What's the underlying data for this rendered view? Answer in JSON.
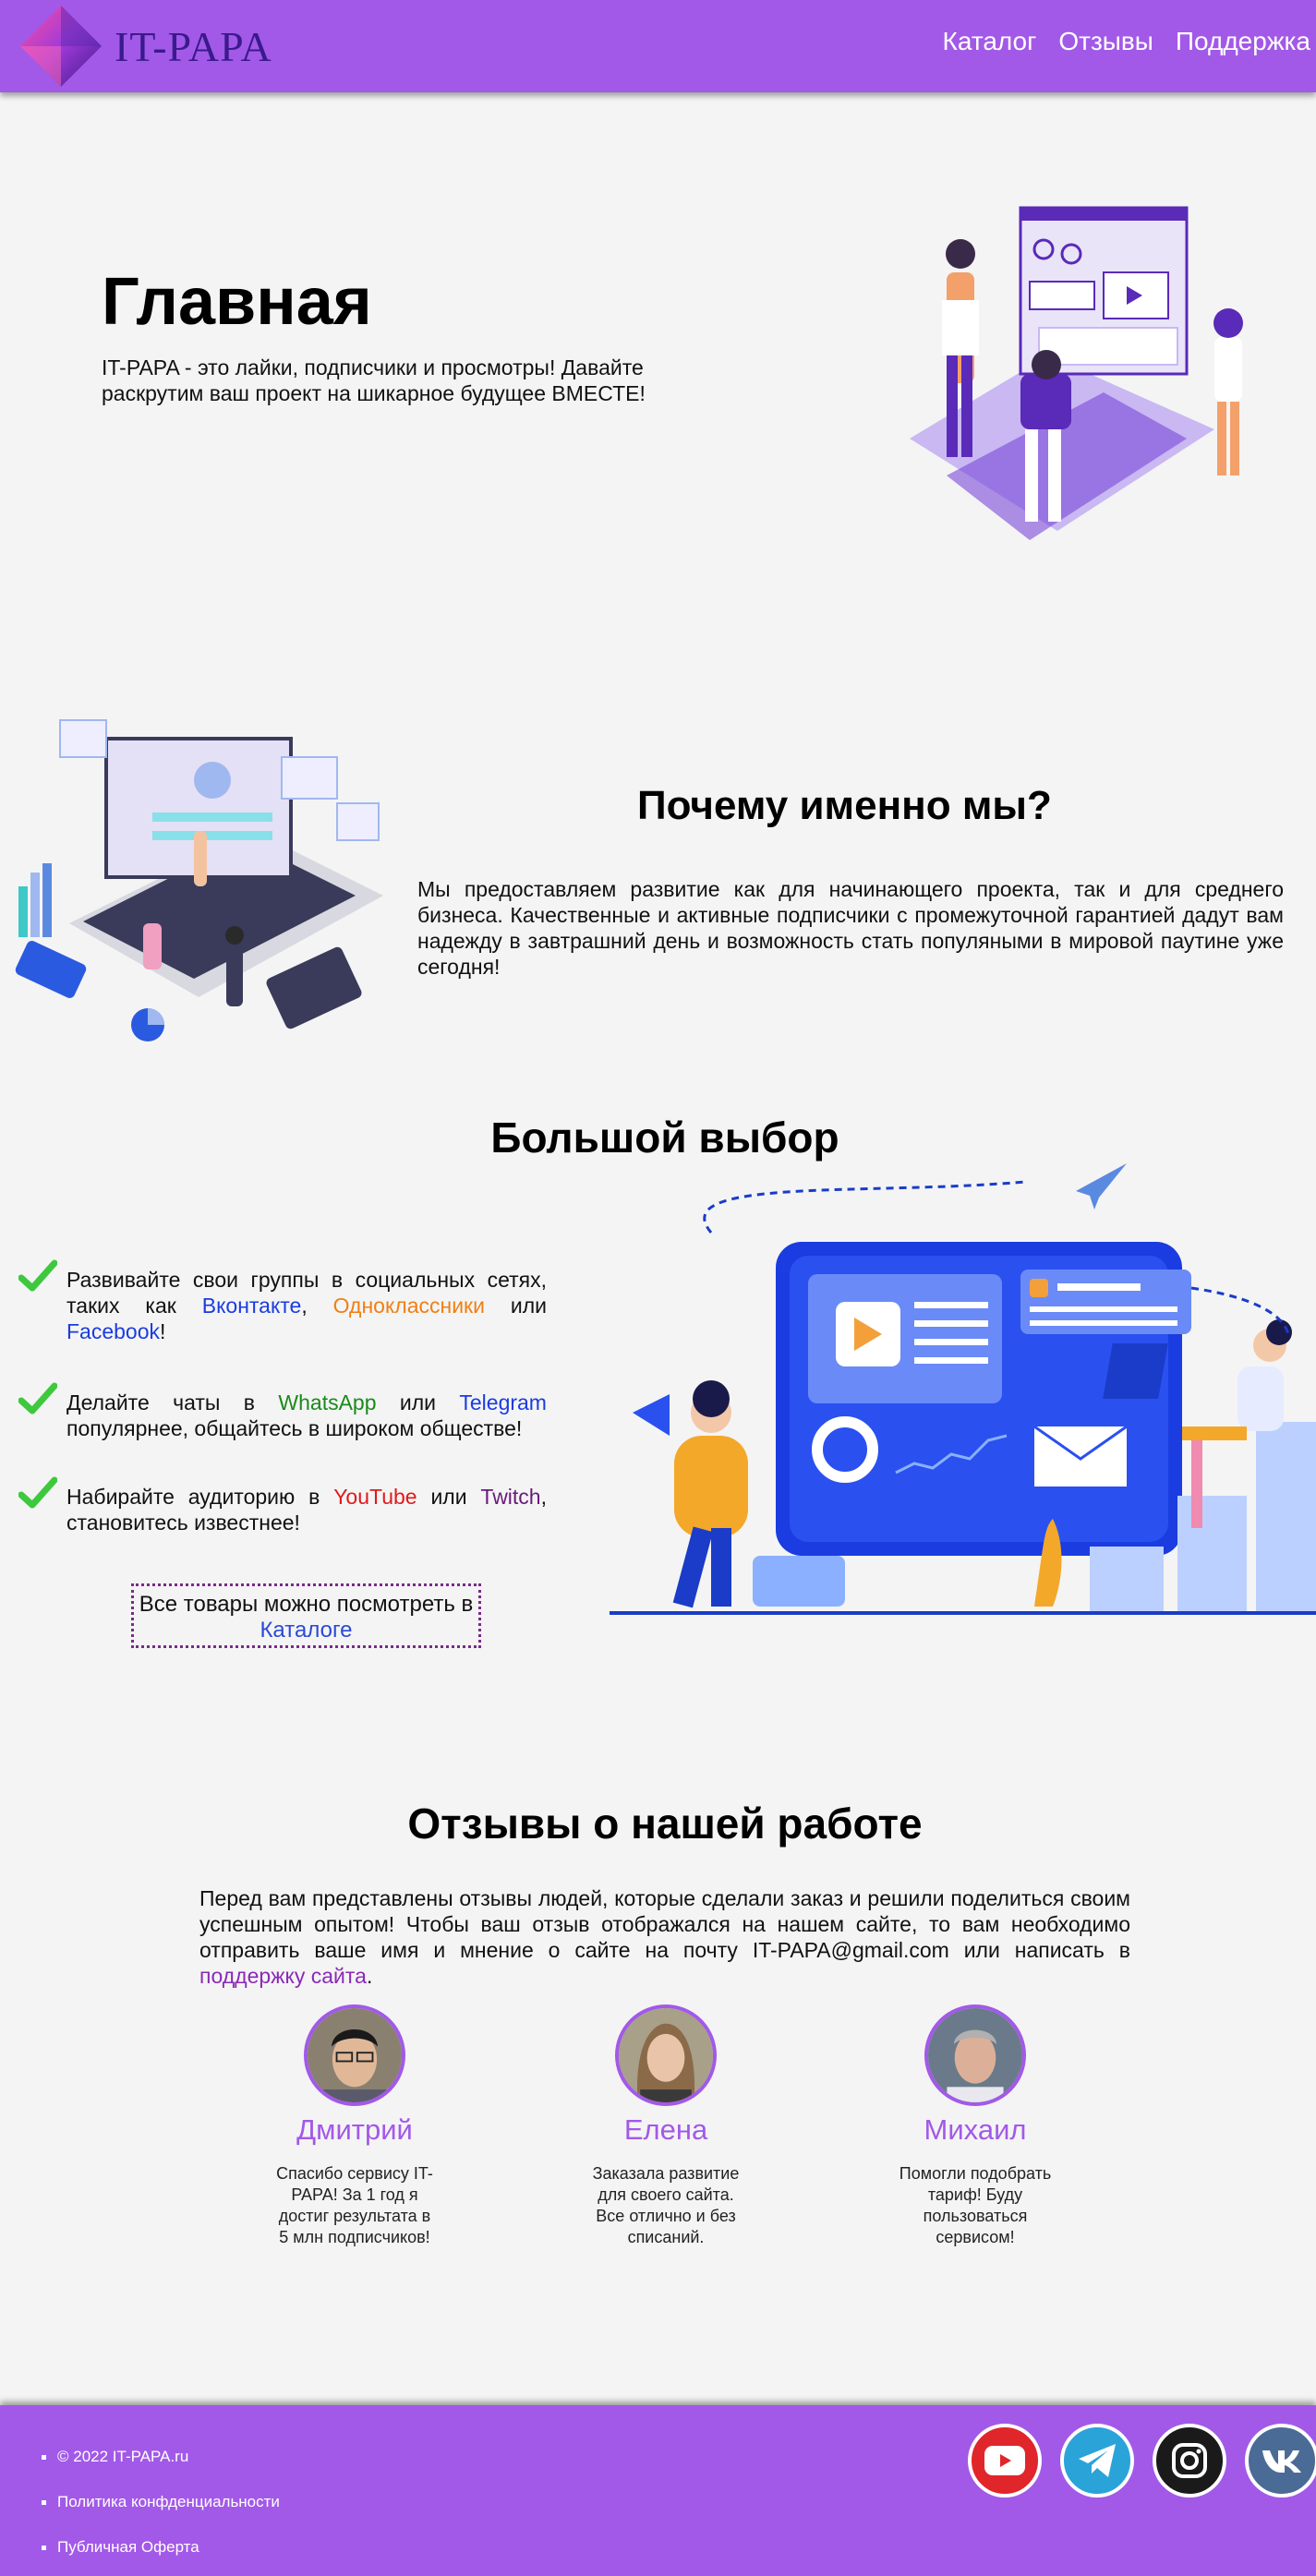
{
  "header": {
    "logo_text": "IT-PAPA",
    "nav": [
      "Каталог",
      "Отзывы",
      "Поддержка"
    ]
  },
  "hero": {
    "title": "Главная",
    "text": "IT-PAPA - это лайки, подписчики и просмотры! Давайте раскрутим ваш проект на шикарное будущее ВМЕСТЕ!"
  },
  "why": {
    "title": "Почему именно мы?",
    "text": "Мы предоставляем развитие как для начинающего проекта, так и для среднего бизнеса. Качественные и активные подписчики с промежуточной гарантией дадут вам надежду в завтрашний день и возможность стать популяными в мировой паутине уже сегодня!"
  },
  "choice": {
    "title": "Большой выбор",
    "f1": {
      "a": "Развивайте свои группы в социальных сетях, таких как ",
      "vk": "Вконтакте",
      "b": ", ",
      "ok": "Одноклассники",
      "c": " или ",
      "fb": "Facebook",
      "d": "!"
    },
    "f2": {
      "a": "Делайте чаты в ",
      "wa": "WhatsApp",
      "b": " или ",
      "tg": "Telegram",
      "c": " популярнее, общайтесь в широком обществе!"
    },
    "f3": {
      "a": "Набирайте аудиторию в ",
      "yt": "YouTube",
      "b": " или ",
      "tw": "Twitch",
      "c": ", становитесь известнее!"
    },
    "catalog_text": "Все товары можно посмотреть в ",
    "catalog_link": "Каталоге"
  },
  "reviews": {
    "title": "Отзывы о нашей работе",
    "text": "Перед вам представлены отзывы людей, которые сделали заказ и решили поделиться своим успешным опытом! Чтобы ваш отзыв отображался на нашем сайте, то вам необходимо отправить ваше имя и мнение о сайте на почту IT-PAPA@gmail.com или написать в ",
    "link": "поддержку сайта",
    "end": ".",
    "items": [
      {
        "name": "Дмитрий",
        "text": "Спасибо сервису IT-PAPA! За 1 год я достиг результата в 5 млн подписчиков!"
      },
      {
        "name": "Елена",
        "text": "Заказала развитие для своего сайта. Все отлично и без списаний."
      },
      {
        "name": "Михаил",
        "text": "Помогли подобрать тариф! Буду пользоваться сервисом!"
      }
    ]
  },
  "footer": {
    "links": [
      "© 2022 IT-PAPA.ru",
      "Политика конфденциальности",
      "Публичная Оферта"
    ],
    "socials": [
      {
        "icon": "youtube-icon",
        "color": "#e0262b"
      },
      {
        "icon": "telegram-icon",
        "color": "#2aa3d9"
      },
      {
        "icon": "instagram-icon",
        "color": "#1a1a1a"
      },
      {
        "icon": "vk-icon",
        "color": "#4a6b95"
      }
    ]
  }
}
